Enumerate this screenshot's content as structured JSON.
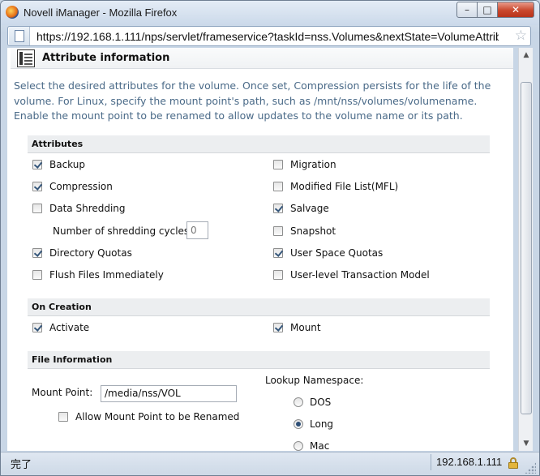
{
  "window": {
    "title": "Novell iManager - Mozilla Firefox",
    "minimize_glyph": "–",
    "maximize_glyph": "□",
    "close_glyph": "✕"
  },
  "urlbar": {
    "url": "https://192.168.1.111/nps/servlet/frameservice?taskId=nss.Volumes&nextState=VolumeAttributes"
  },
  "header": {
    "title": "Attribute information"
  },
  "description": "Select the desired attributes for the volume. Once set, Compression persists for the life of the volume. For Linux, specify the mount point's path, such as /mnt/nss/volumes/volumename. Enable the mount point to be renamed to allow updates to the volume name or its path.",
  "attributes": {
    "heading": "Attributes",
    "backup": {
      "label": "Backup",
      "checked": true
    },
    "compression": {
      "label": "Compression",
      "checked": true
    },
    "data_shredding": {
      "label": "Data Shredding",
      "checked": false
    },
    "shredding_cycles": {
      "label": "Number of shredding cycles:",
      "value": "0"
    },
    "directory_quotas": {
      "label": "Directory Quotas",
      "checked": true
    },
    "flush_files": {
      "label": "Flush Files Immediately",
      "checked": false
    },
    "migration": {
      "label": "Migration",
      "checked": false
    },
    "modified_file_list": {
      "label": "Modified File List(MFL)",
      "checked": false
    },
    "salvage": {
      "label": "Salvage",
      "checked": true
    },
    "snapshot": {
      "label": "Snapshot",
      "checked": false
    },
    "user_space_quotas": {
      "label": "User Space Quotas",
      "checked": true
    },
    "user_level_tm": {
      "label": "User-level Transaction Model",
      "checked": false
    }
  },
  "on_creation": {
    "heading": "On Creation",
    "activate": {
      "label": "Activate",
      "checked": true
    },
    "mount": {
      "label": "Mount",
      "checked": true
    }
  },
  "file_information": {
    "heading": "File Information",
    "mount_point_label": "Mount Point:",
    "mount_point_value": "/media/nss/VOL",
    "allow_rename": {
      "label": "Allow Mount Point to be Renamed",
      "checked": false
    },
    "lookup_namespace_label": "Lookup Namespace:",
    "namespaces": [
      {
        "label": "DOS",
        "selected": false
      },
      {
        "label": "Long",
        "selected": true
      },
      {
        "label": "Mac",
        "selected": false
      }
    ]
  },
  "statusbar": {
    "status": "完了",
    "host": "192.168.1.111"
  }
}
